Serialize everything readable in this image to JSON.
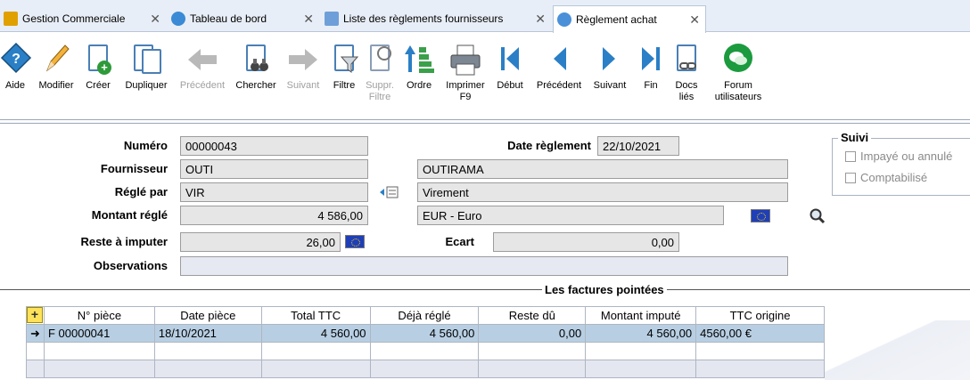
{
  "tabs": [
    {
      "label": "Gestion Commerciale",
      "icon": "app-icon",
      "active": false
    },
    {
      "label": "Tableau de bord",
      "icon": "dashboard-icon",
      "active": false
    },
    {
      "label": "Liste des règlements fournisseurs",
      "icon": "list-icon",
      "active": false
    },
    {
      "label": "Règlement achat",
      "icon": "payment-icon",
      "active": true
    }
  ],
  "toolbar": {
    "aide": "Aide",
    "modifier": "Modifier",
    "creer": "Créer",
    "dupliquer": "Dupliquer",
    "precedent": "Précédent",
    "chercher": "Chercher",
    "suivant": "Suivant",
    "filtre": "Filtre",
    "suppr_filtre_1": "Suppr.",
    "suppr_filtre_2": "Filtre",
    "ordre": "Ordre",
    "imprimer_1": "Imprimer",
    "imprimer_2": "F9",
    "debut": "Début",
    "precedent2": "Précédent",
    "suivant2": "Suivant",
    "fin": "Fin",
    "docs_1": "Docs",
    "docs_2": "liés",
    "forum_1": "Forum",
    "forum_2": "utilisateurs"
  },
  "form": {
    "numero_label": "Numéro",
    "numero": "00000043",
    "date_label": "Date règlement",
    "date": "22/10/2021",
    "fournisseur_label": "Fournisseur",
    "fournisseur_code": "OUTI",
    "fournisseur_name": "OUTIRAMA",
    "regle_par_label": "Réglé par",
    "regle_par_code": "VIR",
    "regle_par_name": "Virement",
    "montant_label": "Montant réglé",
    "montant": "4 586,00",
    "devise": "EUR - Euro",
    "reste_label": "Reste à imputer",
    "reste": "26,00",
    "ecart_label": "Ecart",
    "ecart": "0,00",
    "observations_label": "Observations",
    "observations": ""
  },
  "suivi": {
    "title": "Suivi",
    "impaye": "Impayé ou annulé",
    "comptabilise": "Comptabilisé"
  },
  "grid": {
    "title": "Les factures pointées",
    "add_symbol": "+",
    "columns": [
      "N° pièce",
      "Date pièce",
      "Total TTC",
      "Déjà réglé",
      "Reste dû",
      "Montant imputé",
      "TTC origine"
    ],
    "rows": [
      {
        "piece": "F 00000041",
        "date": "18/10/2021",
        "total": "4 560,00",
        "deja": "4 560,00",
        "reste": "0,00",
        "impute": "4 560,00",
        "origine": "4560,00 €"
      }
    ]
  },
  "colors": {
    "accent": "#1f6fb5",
    "selected_row": "#b8cfe3"
  }
}
